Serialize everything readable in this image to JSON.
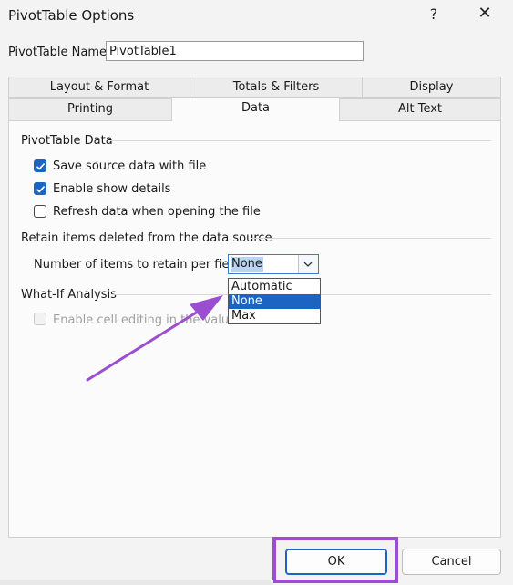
{
  "dialog": {
    "title": "PivotTable Options",
    "help_label": "?",
    "close_label": "✕"
  },
  "name_field": {
    "label": "PivotTable Name:",
    "value": "PivotTable1"
  },
  "tabs": {
    "row1": [
      "Layout & Format",
      "Totals & Filters",
      "Display"
    ],
    "row2": [
      "Printing",
      "Data",
      "Alt Text"
    ],
    "active": "Data"
  },
  "data_tab": {
    "pivot_data": {
      "heading": "PivotTable Data",
      "options": [
        {
          "label": "Save source data with file",
          "checked": true
        },
        {
          "label": "Enable show details",
          "checked": true
        },
        {
          "label": "Refresh data when opening the file",
          "checked": false
        }
      ]
    },
    "retain": {
      "heading": "Retain items deleted from the data source",
      "field_label": "Number of items to retain per field:",
      "selected_value": "None",
      "options": [
        "Automatic",
        "None",
        "Max"
      ],
      "highlighted_option": "None"
    },
    "what_if": {
      "heading": "What-If Analysis",
      "option_label": "Enable cell editing in the values a",
      "enabled": false
    }
  },
  "buttons": {
    "ok": "OK",
    "cancel": "Cancel"
  },
  "colors": {
    "accent": "#1b64c4",
    "annotation_purple": "#9b4fd0"
  }
}
